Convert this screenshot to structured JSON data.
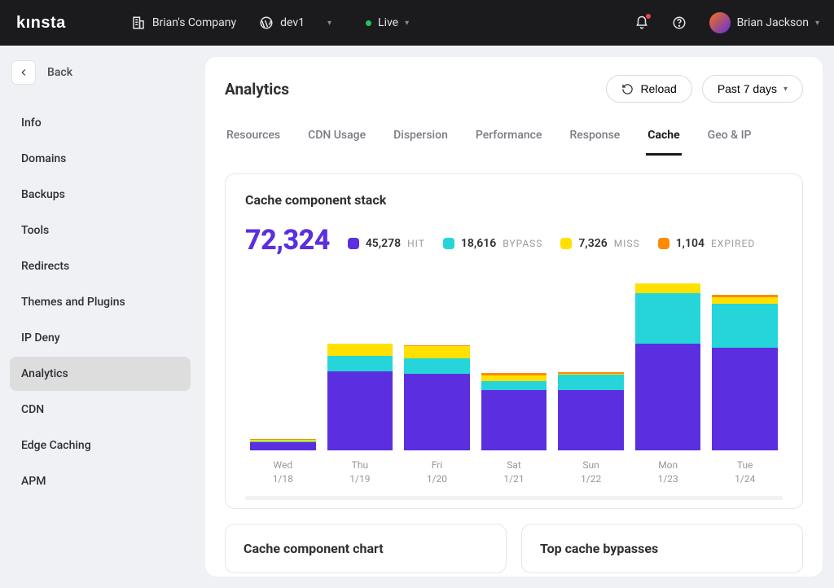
{
  "brand": "kınsta",
  "header": {
    "company": "Brian's Company",
    "site": "dev1",
    "status": "Live",
    "user": "Brian Jackson"
  },
  "sidebar": {
    "back": "Back",
    "items": [
      "Info",
      "Domains",
      "Backups",
      "Tools",
      "Redirects",
      "Themes and Plugins",
      "IP Deny",
      "Analytics",
      "CDN",
      "Edge Caching",
      "APM"
    ],
    "active_index": 7
  },
  "page": {
    "title": "Analytics",
    "reload": "Reload",
    "range": "Past 7 days",
    "tabs": [
      "Resources",
      "CDN Usage",
      "Dispersion",
      "Performance",
      "Response",
      "Cache",
      "Geo & IP"
    ],
    "active_tab_index": 5
  },
  "card": {
    "title": "Cache component stack",
    "total": "72,324",
    "legends": [
      {
        "value": "45,278",
        "label": "HIT",
        "color": "#5b2fe0"
      },
      {
        "value": "18,616",
        "label": "BYPASS",
        "color": "#25d5d9"
      },
      {
        "value": "7,326",
        "label": "MISS",
        "color": "#ffe000"
      },
      {
        "value": "1,104",
        "label": "EXPIRED",
        "color": "#ff8a00"
      }
    ]
  },
  "bottom": {
    "left_title": "Cache component chart",
    "right_title": "Top cache bypasses"
  },
  "chart_data": {
    "type": "bar",
    "stacked": true,
    "categories": [
      {
        "dow": "Wed",
        "date": "1/18"
      },
      {
        "dow": "Thu",
        "date": "1/19"
      },
      {
        "dow": "Fri",
        "date": "1/20"
      },
      {
        "dow": "Sat",
        "date": "1/21"
      },
      {
        "dow": "Sun",
        "date": "1/22"
      },
      {
        "dow": "Mon",
        "date": "1/23"
      },
      {
        "dow": "Tue",
        "date": "1/24"
      }
    ],
    "series": [
      {
        "name": "HIT",
        "color": "#5b2fe0",
        "values": [
          600,
          5800,
          5600,
          4400,
          4400,
          7800,
          7500
        ]
      },
      {
        "name": "BYPASS",
        "color": "#25d5d9",
        "values": [
          50,
          1100,
          1150,
          650,
          1150,
          3700,
          3200
        ]
      },
      {
        "name": "MISS",
        "color": "#ffe000",
        "values": [
          150,
          900,
          900,
          450,
          40,
          700,
          500
        ]
      },
      {
        "name": "EXPIRED",
        "color": "#ff8a00",
        "values": [
          20,
          20,
          20,
          150,
          150,
          20,
          200
        ]
      }
    ],
    "ylim": [
      0,
      12500
    ],
    "title": "Cache component stack",
    "xlabel": "",
    "ylabel": ""
  }
}
